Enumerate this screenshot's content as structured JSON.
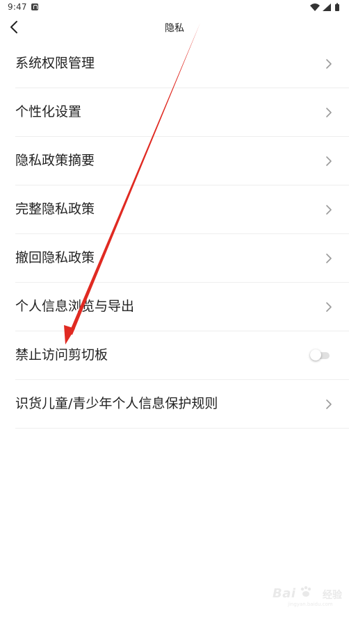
{
  "status_bar": {
    "time": "9:47",
    "icons": [
      "notification-icon",
      "wifi-icon",
      "signal-icon",
      "battery-icon"
    ]
  },
  "header": {
    "title": "隐私",
    "back_icon": "chevron-left-icon"
  },
  "settings": {
    "items": [
      {
        "label": "系统权限管理",
        "control": "chevron"
      },
      {
        "label": "个性化设置",
        "control": "chevron"
      },
      {
        "label": "隐私政策摘要",
        "control": "chevron"
      },
      {
        "label": "完整隐私政策",
        "control": "chevron"
      },
      {
        "label": "撤回隐私政策",
        "control": "chevron"
      },
      {
        "label": "个人信息浏览与导出",
        "control": "chevron"
      },
      {
        "label": "禁止访问剪切板",
        "control": "toggle",
        "toggle_on": false
      },
      {
        "label": "识货儿童/青少年个人信息保护规则",
        "control": "chevron"
      }
    ]
  },
  "watermark": {
    "brand": "Bai",
    "brand_sub": "经验",
    "url": "jingyan.baidu.com"
  },
  "colors": {
    "annotation_arrow": "#e02a22",
    "divider": "#eeeeee",
    "text": "#222222"
  }
}
